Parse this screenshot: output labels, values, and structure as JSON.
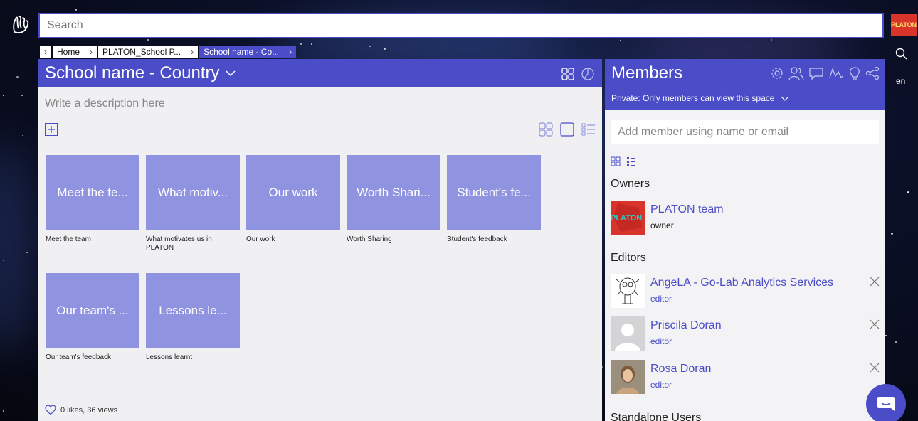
{
  "colors": {
    "accent": "#4b4dc8",
    "tile": "#9093e0",
    "panel": "#f0f0f2"
  },
  "search": {
    "placeholder": "Search"
  },
  "top_avatar": {
    "text": "PLATON"
  },
  "language": "en",
  "breadcrumb": {
    "items": [
      {
        "label": "Home"
      },
      {
        "label": "PLATON_School P..."
      },
      {
        "label": "School name - Co..."
      }
    ]
  },
  "space": {
    "title": "School name - Country",
    "description_placeholder": "Write a description here",
    "tiles": [
      {
        "label": "Meet the te...",
        "caption": "Meet the team"
      },
      {
        "label": "What motiv...",
        "caption": "What motivates us in PLATON"
      },
      {
        "label": "Our work",
        "caption": "Our work"
      },
      {
        "label": "Worth Shari...",
        "caption": "Worth Sharing"
      },
      {
        "label": "Student's fe...",
        "caption": "Student's feedback"
      },
      {
        "label": "Our team's ...",
        "caption": "Our team's feedback"
      },
      {
        "label": "Lessons le...",
        "caption": "Lessons learnt"
      }
    ],
    "likes_text": "0 likes, 36 views"
  },
  "members": {
    "title": "Members",
    "privacy": "Private: Only members can view this space",
    "add_placeholder": "Add member using name or email",
    "owners_label": "Owners",
    "editors_label": "Editors",
    "standalone_label": "Standalone Users",
    "owners": [
      {
        "name": "PLATON team",
        "role": "owner",
        "avatar_text": "PLATON"
      }
    ],
    "editors": [
      {
        "name": "AngeLA - Go-Lab Analytics Services",
        "role": "editor"
      },
      {
        "name": "Priscila Doran",
        "role": "editor"
      },
      {
        "name": "Rosa Doran",
        "role": "editor"
      }
    ]
  }
}
